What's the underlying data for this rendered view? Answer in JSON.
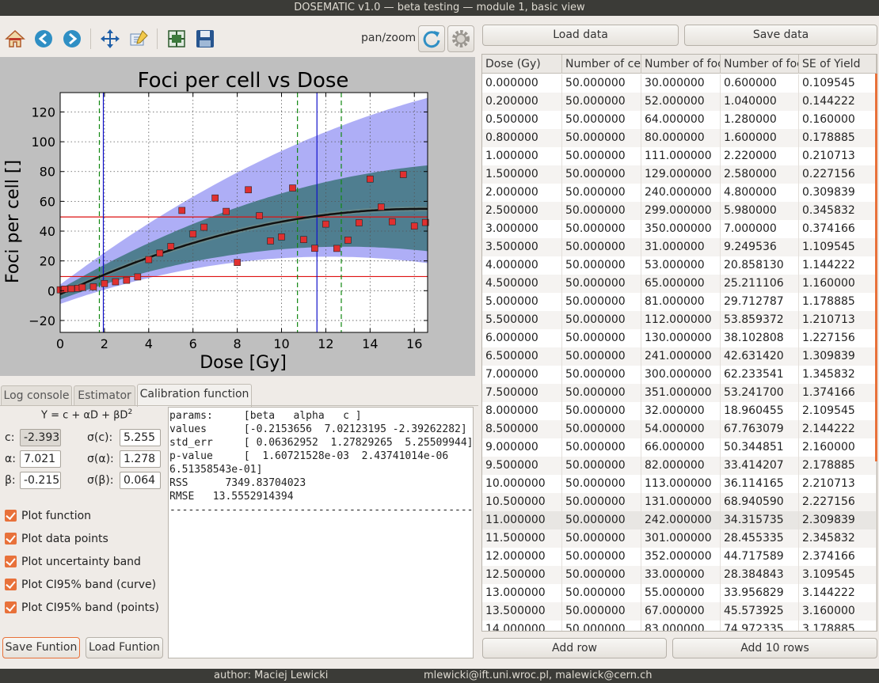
{
  "window": {
    "title": "DOSEMATIC v1.0 — beta testing — module 1, basic view"
  },
  "toolbar": {
    "icons": [
      "home-icon",
      "back-arrow-icon",
      "forward-arrow-icon",
      "pan-icon",
      "zoom-edit-icon",
      "configure-subplots-icon",
      "save-icon",
      "refresh-icon",
      "gear-icon"
    ],
    "mode_label": "pan/zoom"
  },
  "chart_data": {
    "type": "scatter",
    "title": "Foci per cell vs Dose",
    "xlabel": "Dose [Gy]",
    "ylabel": "Foci per cell []",
    "xlim": [
      0,
      16.6
    ],
    "ylim": [
      -28,
      133
    ],
    "xticks": [
      0,
      2,
      4,
      6,
      8,
      10,
      12,
      14,
      16
    ],
    "yticks": [
      -20,
      0,
      20,
      40,
      60,
      80,
      100,
      120
    ],
    "grid": true,
    "points": {
      "x": [
        0,
        0.2,
        0.5,
        0.8,
        1.0,
        1.5,
        2.0,
        2.5,
        3.0,
        3.5,
        4.0,
        4.5,
        5.0,
        5.5,
        6.0,
        6.5,
        7.0,
        7.5,
        8.0,
        8.5,
        9.0,
        9.5,
        10.0,
        10.5,
        11.0,
        11.5,
        12.0,
        12.5,
        13.0,
        13.5,
        14.0,
        14.5,
        15.0,
        15.5,
        16.0,
        16.5
      ],
      "y": [
        0.6,
        1.04,
        1.28,
        1.6,
        2.22,
        2.58,
        4.8,
        5.98,
        7.0,
        9.25,
        20.86,
        25.21,
        29.71,
        53.86,
        38.1,
        42.63,
        62.23,
        53.24,
        18.96,
        67.76,
        50.34,
        33.41,
        36.11,
        68.94,
        34.32,
        28.46,
        44.72,
        28.38,
        33.96,
        45.57,
        74.97,
        56.2,
        46.3,
        78.0,
        43.4,
        45.8
      ],
      "color": "#e03030"
    },
    "fit": {
      "c": -2.393,
      "alpha": 7.021,
      "beta": -0.215,
      "color": "#111111"
    },
    "band_curve": {
      "color": "#2f6e6e"
    },
    "band_points": {
      "color": "#7878f0"
    },
    "hlines": [
      {
        "y": 49.5,
        "color": "#dd1111"
      },
      {
        "y": 9.5,
        "color": "#dd1111"
      }
    ],
    "vlines": [
      {
        "x": 1.77,
        "color": "#118811",
        "style": "dashed"
      },
      {
        "x": 1.95,
        "color": "#1111cc",
        "style": "solid"
      },
      {
        "x": 10.72,
        "color": "#118811",
        "style": "dashed"
      },
      {
        "x": 11.6,
        "color": "#1111cc",
        "style": "solid"
      },
      {
        "x": 12.7,
        "color": "#118811",
        "style": "dashed"
      }
    ]
  },
  "tabs": [
    {
      "label": "Log console",
      "active": false
    },
    {
      "label": "Estimator",
      "active": false
    },
    {
      "label": "Calibration function",
      "active": true
    }
  ],
  "calibration": {
    "formula": {
      "left": "Y = c + αD + βD",
      "exp": "2"
    },
    "labels": {
      "c": "c:",
      "alpha": "α:",
      "beta": "β:",
      "sc": "σ(c):",
      "sa": "σ(α):",
      "sb": "σ(β):"
    },
    "values": {
      "c": "-2.393",
      "alpha": "7.021",
      "beta": "-0.215",
      "sc": "5.255",
      "sa": "1.278",
      "sb": "0.064"
    },
    "checkboxes": [
      "Plot function",
      "Plot data points",
      "Plot uncertainty band",
      "Plot CI95% band (curve)",
      "Plot CI95% band (points)"
    ],
    "save_label": "Save Funtion",
    "load_label": "Load Funtion"
  },
  "log_text": "params:     [beta   alpha   c ]\nvalues      [-0.2153656  7.02123195 -2.39262282]\nstd_err     [ 0.06362952  1.27829265  5.25509944]\np-value     [  1.60721528e-03  2.43741014e-06\n6.51358543e-01]\nRSS      7349.83704023\nRMSE   13.5552914394\n--------------------------------------------------------------",
  "data_panel": {
    "load_label": "Load data",
    "save_label": "Save data",
    "columns": [
      "Dose (Gy)",
      "Number of cells",
      "Number of foci",
      "Number of foci per cell",
      "SE of Yield"
    ],
    "rows": [
      [
        "0.000000",
        "50.000000",
        "30.000000",
        "0.600000",
        "0.109545"
      ],
      [
        "0.200000",
        "50.000000",
        "52.000000",
        "1.040000",
        "0.144222"
      ],
      [
        "0.500000",
        "50.000000",
        "64.000000",
        "1.280000",
        "0.160000"
      ],
      [
        "0.800000",
        "50.000000",
        "80.000000",
        "1.600000",
        "0.178885"
      ],
      [
        "1.000000",
        "50.000000",
        "111.000000",
        "2.220000",
        "0.210713"
      ],
      [
        "1.500000",
        "50.000000",
        "129.000000",
        "2.580000",
        "0.227156"
      ],
      [
        "2.000000",
        "50.000000",
        "240.000000",
        "4.800000",
        "0.309839"
      ],
      [
        "2.500000",
        "50.000000",
        "299.000000",
        "5.980000",
        "0.345832"
      ],
      [
        "3.000000",
        "50.000000",
        "350.000000",
        "7.000000",
        "0.374166"
      ],
      [
        "3.500000",
        "50.000000",
        "31.000000",
        "9.249536",
        "1.109545"
      ],
      [
        "4.000000",
        "50.000000",
        "53.000000",
        "20.858130",
        "1.144222"
      ],
      [
        "4.500000",
        "50.000000",
        "65.000000",
        "25.211106",
        "1.160000"
      ],
      [
        "5.000000",
        "50.000000",
        "81.000000",
        "29.712787",
        "1.178885"
      ],
      [
        "5.500000",
        "50.000000",
        "112.000000",
        "53.859372",
        "1.210713"
      ],
      [
        "6.000000",
        "50.000000",
        "130.000000",
        "38.102808",
        "1.227156"
      ],
      [
        "6.500000",
        "50.000000",
        "241.000000",
        "42.631420",
        "1.309839"
      ],
      [
        "7.000000",
        "50.000000",
        "300.000000",
        "62.233541",
        "1.345832"
      ],
      [
        "7.500000",
        "50.000000",
        "351.000000",
        "53.241700",
        "1.374166"
      ],
      [
        "8.000000",
        "50.000000",
        "32.000000",
        "18.960455",
        "2.109545"
      ],
      [
        "8.500000",
        "50.000000",
        "54.000000",
        "67.763079",
        "2.144222"
      ],
      [
        "9.000000",
        "50.000000",
        "66.000000",
        "50.344851",
        "2.160000"
      ],
      [
        "9.500000",
        "50.000000",
        "82.000000",
        "33.414207",
        "2.178885"
      ],
      [
        "10.000000",
        "50.000000",
        "113.000000",
        "36.114165",
        "2.210713"
      ],
      [
        "10.500000",
        "50.000000",
        "131.000000",
        "68.940590",
        "2.227156"
      ],
      [
        "11.000000",
        "50.000000",
        "242.000000",
        "34.315735",
        "2.309839"
      ],
      [
        "11.500000",
        "50.000000",
        "301.000000",
        "28.455335",
        "2.345832"
      ],
      [
        "12.000000",
        "50.000000",
        "352.000000",
        "44.717589",
        "2.374166"
      ],
      [
        "12.500000",
        "50.000000",
        "33.000000",
        "28.384843",
        "3.109545"
      ],
      [
        "13.000000",
        "50.000000",
        "55.000000",
        "33.956829",
        "3.144222"
      ],
      [
        "13.500000",
        "50.000000",
        "67.000000",
        "45.573925",
        "3.160000"
      ],
      [
        "14.000000",
        "50.000000",
        "83.000000",
        "74.972335",
        "3.178885"
      ]
    ],
    "selected_row": 24,
    "add_row_label": "Add row",
    "add_10_label": "Add 10 rows"
  },
  "footer": {
    "author": "author: Maciej Lewicki",
    "emails": "mlewicki@ift.uni.wroc.pl,  malewick@cern.ch"
  },
  "colors": {
    "accent": "#e8713a",
    "titlebar": "#3b3b37"
  }
}
